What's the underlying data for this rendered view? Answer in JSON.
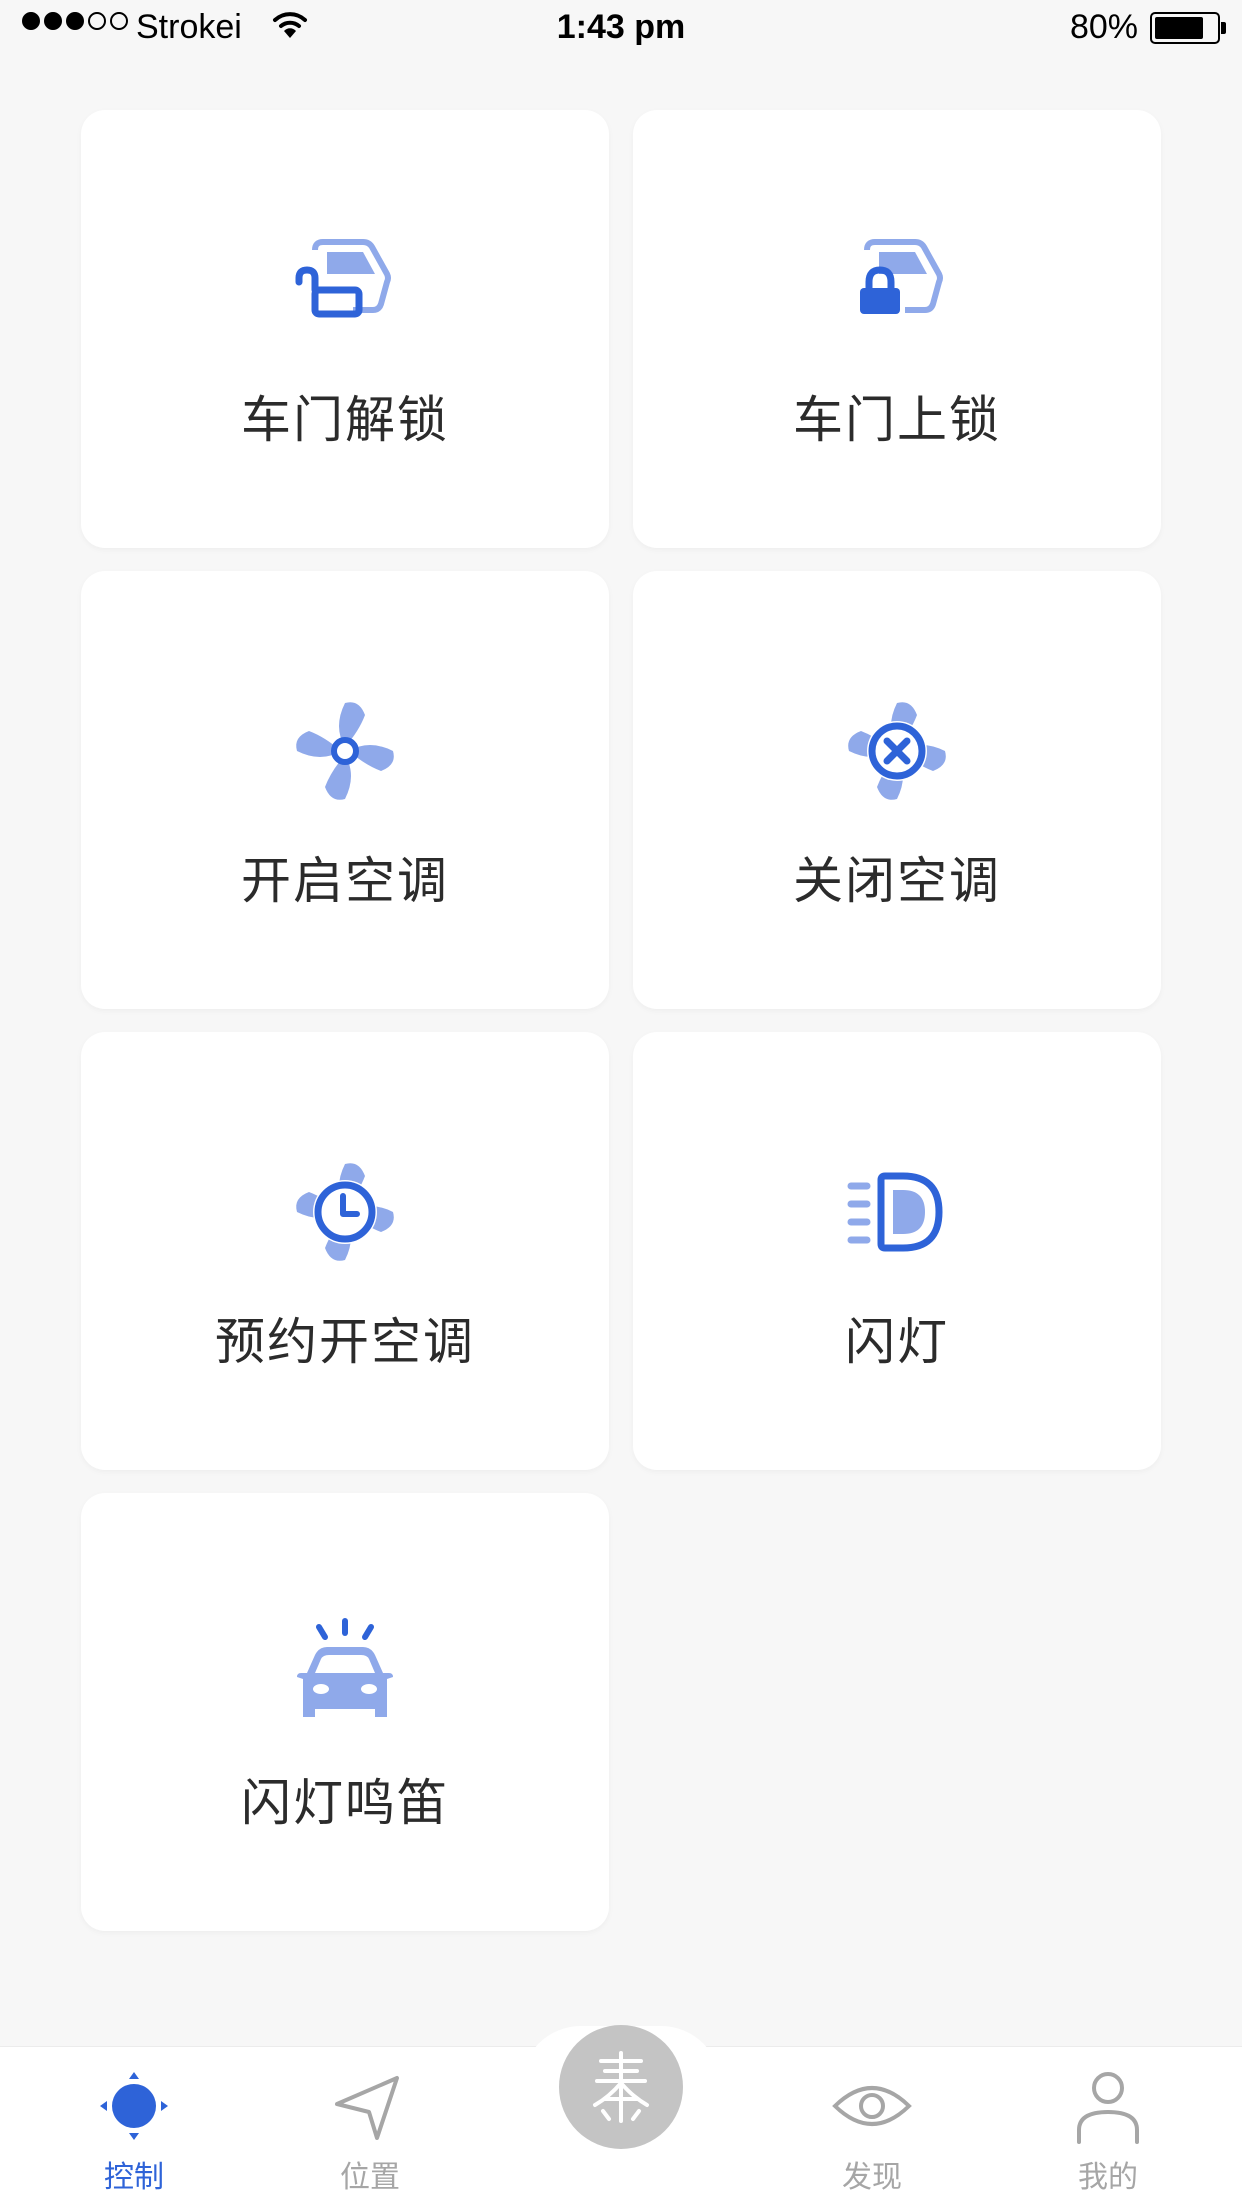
{
  "status_bar": {
    "carrier": "Strokei",
    "time": "1:43 pm",
    "battery_percent": "80%",
    "battery_level": 0.8,
    "signal_strength": 3
  },
  "colors": {
    "primary": "#2e63d8",
    "light": "#8fa9ea",
    "background": "#f7f7f7",
    "inactive": "#a6a6a6"
  },
  "controls": [
    {
      "label": "车门解锁",
      "icon": "door-unlock-icon"
    },
    {
      "label": "车门上锁",
      "icon": "door-lock-icon"
    },
    {
      "label": "开启空调",
      "icon": "ac-on-icon"
    },
    {
      "label": "关闭空调",
      "icon": "ac-off-icon"
    },
    {
      "label": "预约开空调",
      "icon": "ac-schedule-icon"
    },
    {
      "label": "闪灯",
      "icon": "headlight-icon"
    },
    {
      "label": "闪灯鸣笛",
      "icon": "car-horn-icon"
    }
  ],
  "tab_bar": {
    "items": [
      {
        "label": "控制",
        "icon": "control-icon",
        "active": true
      },
      {
        "label": "位置",
        "icon": "location-arrow-icon",
        "active": false
      },
      {
        "label": "",
        "icon": "qin-logo-icon",
        "active": false
      },
      {
        "label": "发现",
        "icon": "eye-icon",
        "active": false
      },
      {
        "label": "我的",
        "icon": "profile-icon",
        "active": false
      }
    ]
  }
}
